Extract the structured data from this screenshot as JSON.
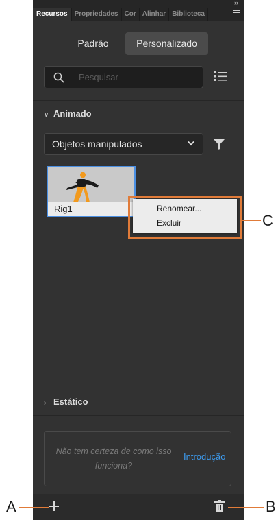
{
  "tabs": [
    "Recursos",
    "Propriedades",
    "Cor",
    "Alinhar",
    "Biblioteca"
  ],
  "active_tab_index": 0,
  "segments": {
    "padrao": "Padrão",
    "personalizado": "Personalizado",
    "selected": "Personalizado"
  },
  "search": {
    "placeholder": "Pesquisar"
  },
  "sections": {
    "animado": "Animado",
    "estatico": "Estático"
  },
  "filter_dropdown": {
    "value": "Objetos manipulados"
  },
  "asset": {
    "name": "Rig1"
  },
  "context_menu": {
    "items": [
      "Renomear...",
      "Excluir"
    ]
  },
  "help": {
    "text": "Não tem certeza de como isso funciona?",
    "link": "Introdução"
  },
  "annotations": {
    "a": "A",
    "b": "B",
    "c": "C"
  },
  "colors": {
    "panel_bg": "#323232",
    "accent_link": "#3d9cf0",
    "selection_border": "#4b8fe2",
    "annotation": "#e07b39"
  },
  "icons": [
    "collapse-icon",
    "panel-menu-icon",
    "search-icon",
    "list-view-icon",
    "chevron-down-icon",
    "chevron-right-icon",
    "filter-icon",
    "add-icon",
    "trash-icon"
  ]
}
